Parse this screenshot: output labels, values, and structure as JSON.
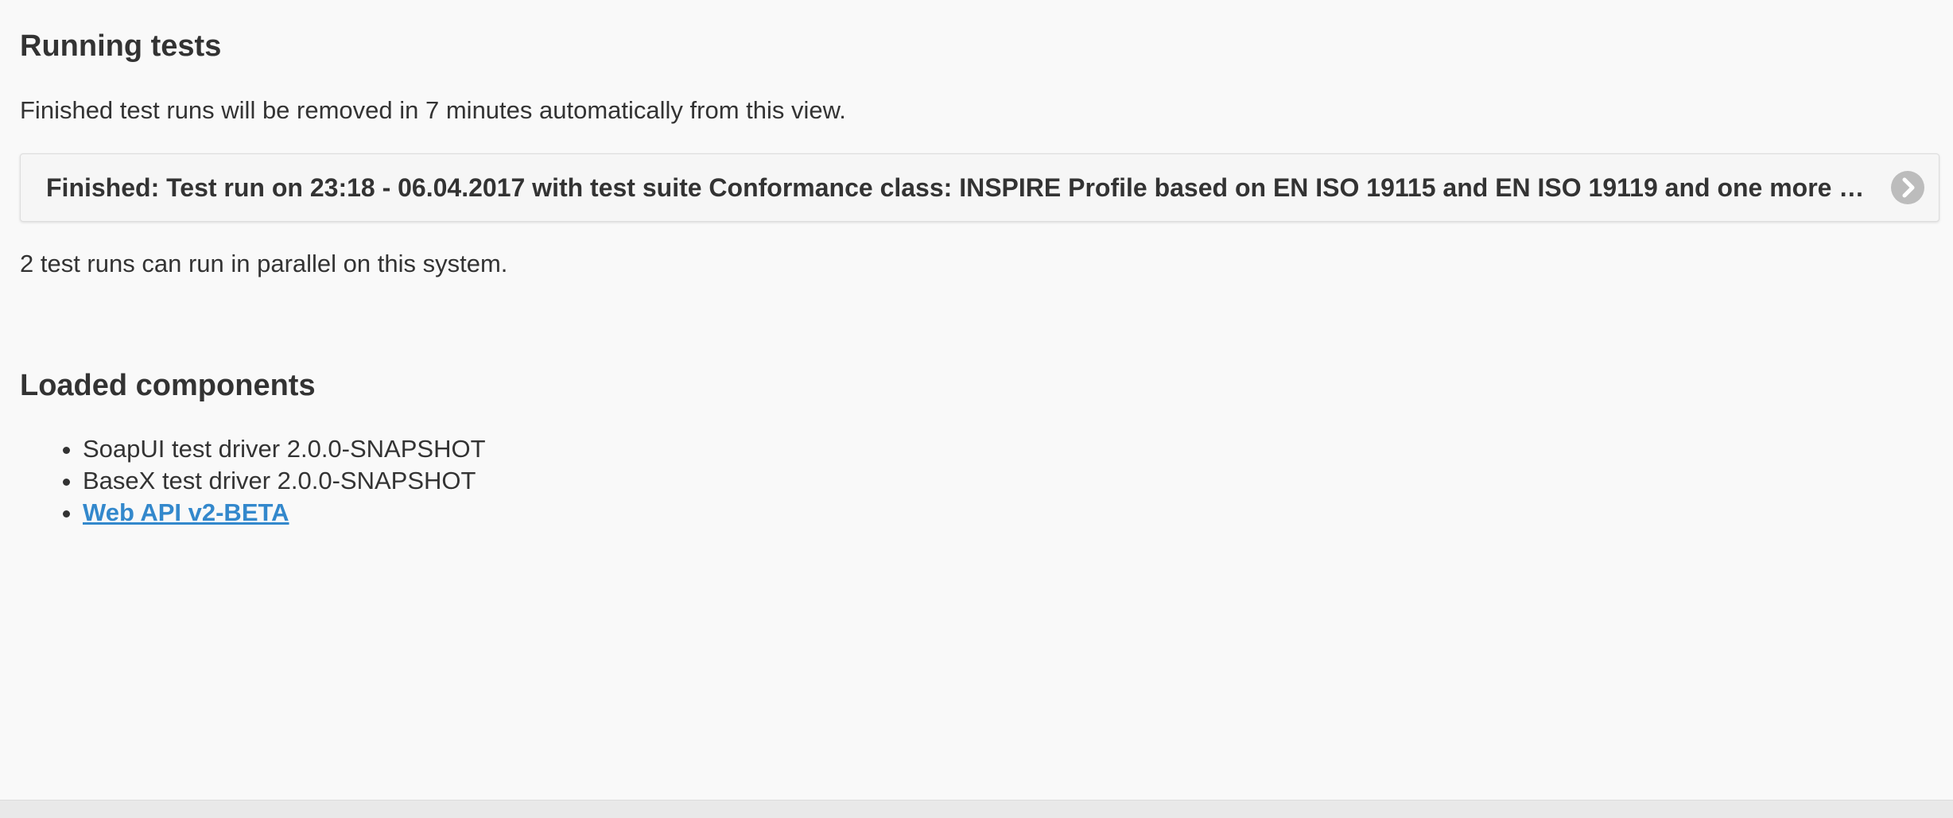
{
  "running_tests": {
    "title": "Running tests",
    "notice": "Finished test runs will be removed in 7 minutes automatically from this view.",
    "runs": [
      {
        "label": "Finished: Test run on 23:18 - 06.04.2017 with test suite Conformance class: INSPIRE Profile based on EN ISO 19115 and EN ISO 19119 and one more test suite",
        "icon": "chevron-right-icon"
      }
    ],
    "parallel_info": "2 test runs can run in parallel on this system."
  },
  "loaded_components": {
    "title": "Loaded components",
    "items": [
      {
        "label": "SoapUI test driver 2.0.0-SNAPSHOT",
        "link": false
      },
      {
        "label": "BaseX test driver 2.0.0-SNAPSHOT",
        "link": false
      },
      {
        "label": "Web API v2-BETA",
        "link": true
      }
    ]
  },
  "colors": {
    "background": "#f9f9f9",
    "text": "#333333",
    "link": "#3388cc",
    "icon_bg": "#bcbcbc"
  }
}
